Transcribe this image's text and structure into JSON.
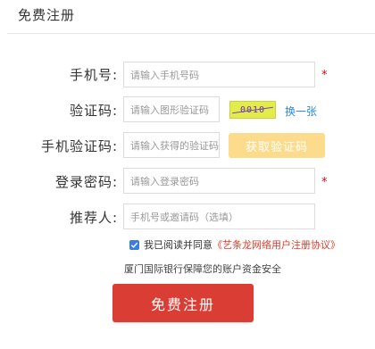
{
  "header": {
    "title": "免费注册"
  },
  "form": {
    "phone": {
      "label": "手机号:",
      "placeholder": "请输入手机号码",
      "required": "*"
    },
    "captcha": {
      "label": "验证码:",
      "placeholder": "请输入图形验证码",
      "image_text": "0010",
      "refresh": "换一张"
    },
    "sms": {
      "label": "手机验证码:",
      "placeholder": "请输入获得的验证码",
      "button": "获取验证码"
    },
    "password": {
      "label": "登录密码:",
      "placeholder": "请输入登录密码",
      "required": "*"
    },
    "referrer": {
      "label": "推荐人:",
      "placeholder": "手机号或邀请码（选填）"
    }
  },
  "agreement": {
    "checked": true,
    "text": "我已阅读并同意",
    "link": "《艺条龙网络用户注册协议》"
  },
  "bank_note": "厦门国际银行保障您的账户资金安全",
  "submit": {
    "label": "免费注册"
  },
  "colors": {
    "accent": "#d93d33",
    "sms_button": "#fcdc8c",
    "link": "#2b8ad8",
    "required": "#e60012",
    "checkbox": "#3b7de0"
  }
}
